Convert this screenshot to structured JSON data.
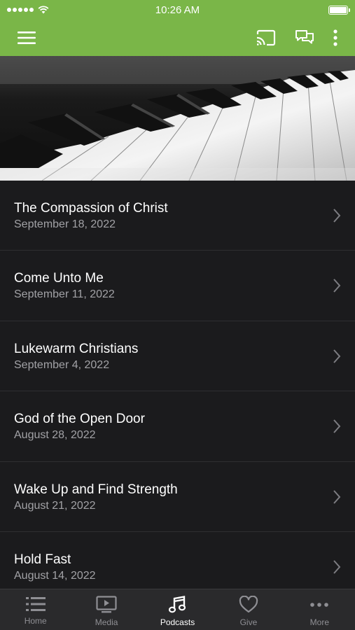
{
  "status_bar": {
    "time": "10:26 AM",
    "icons": [
      "signal-dots",
      "wifi-icon",
      "battery-icon"
    ]
  },
  "app_bar": {
    "background": "#7ab648",
    "icons": [
      "menu-icon",
      "cast-icon",
      "chat-icon",
      "more-vertical-icon"
    ]
  },
  "hero": {
    "image": "piano-keys"
  },
  "podcasts": [
    {
      "title": "The Compassion of Christ",
      "date": "September 18, 2022"
    },
    {
      "title": "Come Unto Me",
      "date": "September 11, 2022"
    },
    {
      "title": "Lukewarm Christians",
      "date": "September 4, 2022"
    },
    {
      "title": "God of the Open Door",
      "date": "August 28, 2022"
    },
    {
      "title": "Wake Up and Find Strength",
      "date": "August 21, 2022"
    },
    {
      "title": "Hold Fast",
      "date": "August 14, 2022"
    }
  ],
  "tabs": [
    {
      "label": "Home",
      "icon": "list-icon"
    },
    {
      "label": "Media",
      "icon": "tv-play-icon"
    },
    {
      "label": "Podcasts",
      "icon": "music-note-icon",
      "active": true
    },
    {
      "label": "Give",
      "icon": "heart-icon"
    },
    {
      "label": "More",
      "icon": "ellipsis-icon"
    }
  ]
}
